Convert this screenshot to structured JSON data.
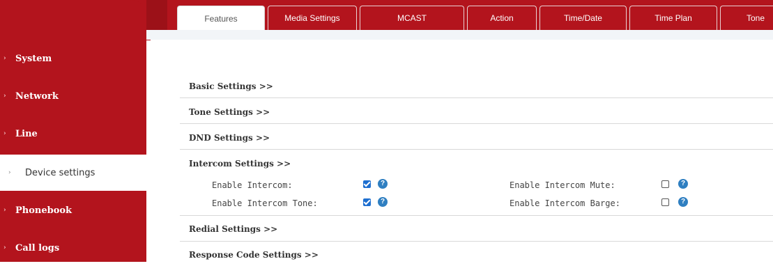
{
  "sidebar": {
    "items": [
      {
        "label": "System",
        "active": false
      },
      {
        "label": "Network",
        "active": false
      },
      {
        "label": "Line",
        "active": false
      },
      {
        "label": "Device settings",
        "active": true
      },
      {
        "label": "Phonebook",
        "active": false
      },
      {
        "label": "Call logs",
        "active": false
      }
    ]
  },
  "tabs": [
    {
      "label": "Features",
      "active": true
    },
    {
      "label": "Media Settings",
      "active": false
    },
    {
      "label": "MCAST",
      "active": false
    },
    {
      "label": "Action",
      "active": false
    },
    {
      "label": "Time/Date",
      "active": false
    },
    {
      "label": "Time Plan",
      "active": false
    },
    {
      "label": "Tone",
      "active": false
    }
  ],
  "sections": {
    "basic": "Basic Settings >>",
    "tone": "Tone Settings >>",
    "dnd": "DND Settings >>",
    "intercom": "Intercom Settings >>",
    "redial": "Redial Settings >>",
    "response": "Response Code Settings >>"
  },
  "intercom": {
    "enable_intercom": {
      "label": "Enable Intercom:",
      "checked": true
    },
    "enable_intercom_tone": {
      "label": "Enable Intercom Tone:",
      "checked": true
    },
    "enable_intercom_mute": {
      "label": "Enable Intercom Mute:",
      "checked": false
    },
    "enable_intercom_barge": {
      "label": "Enable Intercom Barge:",
      "checked": false
    }
  },
  "icons": {
    "help": "?",
    "arrow": "›"
  },
  "colors": {
    "brand_red": "#b3141d",
    "checkbox_blue": "#1e6fd0",
    "help_blue": "#2f7fc1"
  }
}
